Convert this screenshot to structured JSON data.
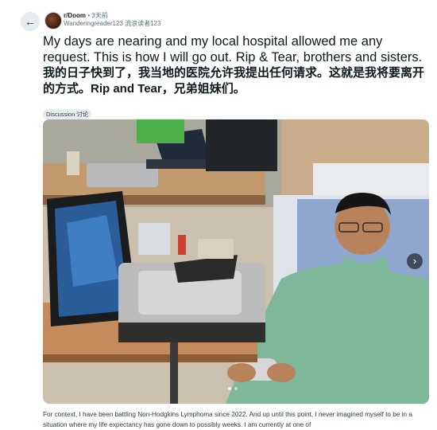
{
  "post": {
    "subreddit": "r/Doom",
    "separator": "•",
    "time": "3天前",
    "author": "Wanderingreader123",
    "author_translated": "流浪读者123",
    "title": "My days are nearing and my local hospital allowed me any request. This is how I will go out. Rip & Tear, brothers and sisters.",
    "title_translated": "我的日子快到了，我当地的医院允许我提出任何请求。这就是我将要离开的方式。Rip and Tear，兄弟姐妹们。",
    "flair": "Discussion",
    "flair_translated": "讨论",
    "body": "For context, I have been battling Non-Hodgkins Lymphoma since 2022. And up until this point, I never imagined myself to be in a situation where my life expectancy has gone down to possibly weeks. I am currently at one of"
  },
  "nav": {
    "back_icon": "←",
    "next_icon": "›"
  },
  "carousel": {
    "total": 2,
    "current": 1
  },
  "colors": {
    "page_bg": "#ffffff",
    "text": "#0f1a1c",
    "muted": "#576f76",
    "flair_bg": "#eaedef"
  }
}
